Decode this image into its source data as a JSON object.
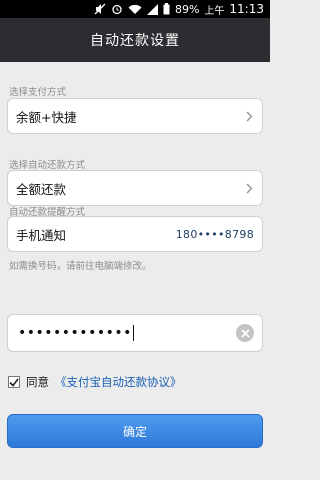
{
  "status_bar": {
    "battery_percent": "89%",
    "am_pm": "上午",
    "time": "11:13",
    "icons": [
      "mute-icon",
      "alarm-icon",
      "wifi-icon",
      "cell-signal-icon",
      "battery-icon"
    ]
  },
  "header": {
    "title": "自动还款设置"
  },
  "payment_method": {
    "label": "选择支付方式",
    "value": "余额+快捷"
  },
  "repay_method": {
    "label": "选择自动还款方式",
    "value": "全额还款"
  },
  "reminder": {
    "label": "自动还款提醒方式",
    "value": "手机通知",
    "phone": "180••••8798",
    "hint": "如需换号码，请前往电脑端修改。"
  },
  "password": {
    "value": "•••••••••••••"
  },
  "agreement": {
    "prefix": "同意",
    "link": "《支付宝自动还款协议》",
    "checked": true
  },
  "confirm_button": {
    "label": "确定"
  },
  "colors": {
    "header_bg": "#2b2d31",
    "link": "#1a5fb4",
    "button": "#3a86e3"
  }
}
